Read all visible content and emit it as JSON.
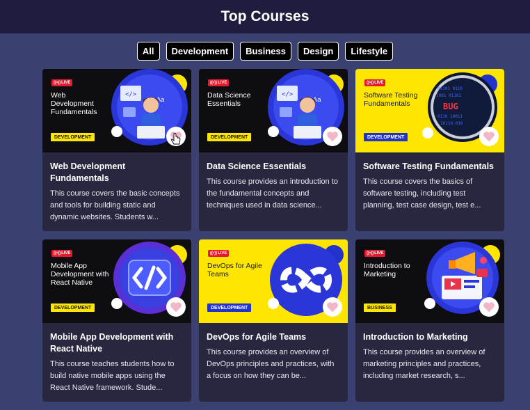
{
  "header": {
    "title": "Top Courses"
  },
  "filters": [
    "All",
    "Development",
    "Business",
    "Design",
    "Lifestyle"
  ],
  "live_label": "LIVE",
  "courses": [
    {
      "thumb_title": "Web Development Fundamentals",
      "thumb_bg": "dark",
      "category": "DEVELOPMENT",
      "tag_style": "y",
      "illustration": "developer-with-laptop",
      "title": "Web Development Fundamentals",
      "description": "This course covers the basic concepts and tools for building static and dynamic websites. Students w..."
    },
    {
      "thumb_title": "Data Science Essentials",
      "thumb_bg": "dark",
      "category": "DEVELOPMENT",
      "tag_style": "y",
      "illustration": "developer-with-laptop",
      "title": "Data Science Essentials",
      "description": "This course provides an introduction to the fundamental concepts and techniques used in data science..."
    },
    {
      "thumb_title": "Software Testing Fundamentals",
      "thumb_bg": "yellow",
      "category": "DEVELOPMENT",
      "tag_style": "b",
      "illustration": "bug-magnifier",
      "title": "Software Testing Fundamentals",
      "description": "This course covers the basics of software testing, including test planning, test case design, test e..."
    },
    {
      "thumb_title": "Mobile App Development with React Native",
      "thumb_bg": "dark",
      "category": "DEVELOPMENT",
      "tag_style": "y",
      "illustration": "code-brackets",
      "title": "Mobile App Development with React Native",
      "description": "This course teaches students how to build native mobile apps using the React Native framework. Stude..."
    },
    {
      "thumb_title": "DevOps for Agile Teams",
      "thumb_bg": "yellow",
      "category": "DEVELOPMENT",
      "tag_style": "b",
      "illustration": "infinity-loop",
      "title": "DevOps for Agile Teams",
      "description": "This course provides an overview of DevOps principles and practices, with a focus on how they can be..."
    },
    {
      "thumb_title": "Introduction to Marketing",
      "thumb_bg": "dark",
      "category": "BUSINESS",
      "tag_style": "y",
      "illustration": "megaphone-marketing",
      "title": "Introduction to Marketing",
      "description": "This course provides an overview of marketing principles and practices, including market research, s..."
    }
  ],
  "colors": {
    "background": "#3a4070",
    "header": "#1f1d3d",
    "card": "#29273f",
    "accent_yellow": "#fee600",
    "accent_blue": "#2233cc",
    "live_red": "#e8192c",
    "heart": "#f3b6c9"
  }
}
